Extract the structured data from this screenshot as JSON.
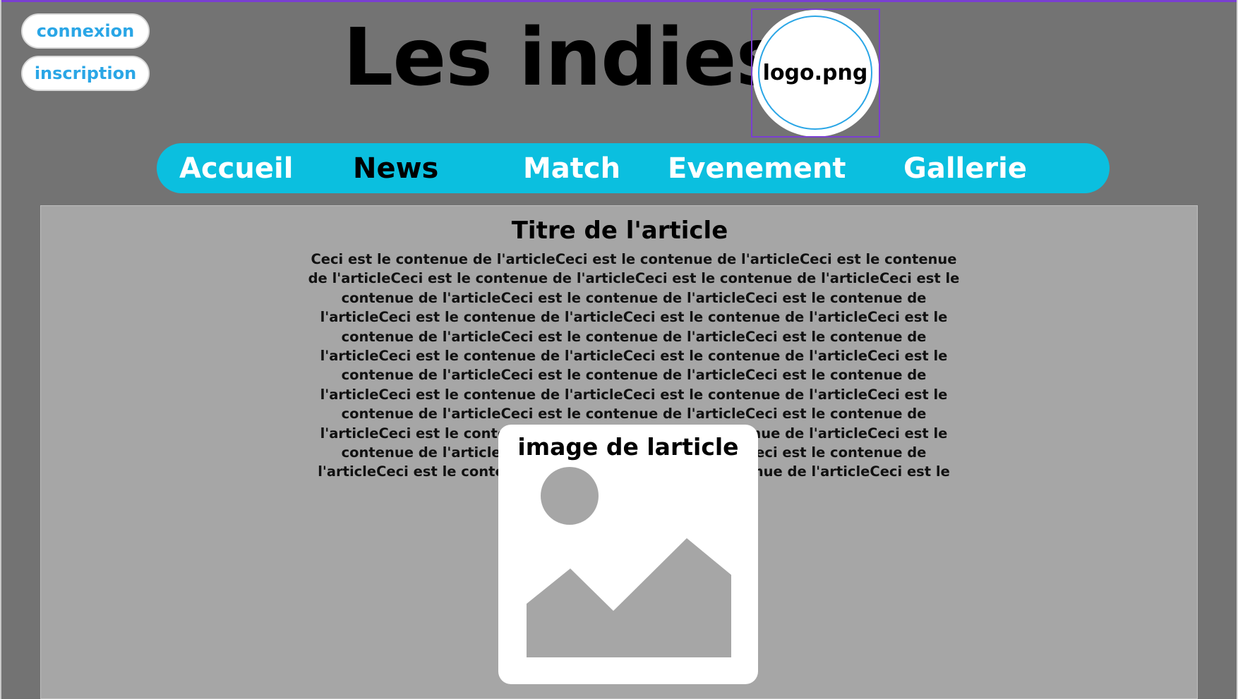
{
  "auth": {
    "login_label": "connexion",
    "register_label": "inscription"
  },
  "header": {
    "site_title": "Les indies",
    "logo_text": "logo.png"
  },
  "nav": {
    "items": [
      {
        "label": "Accueil",
        "active": false
      },
      {
        "label": "News",
        "active": true
      },
      {
        "label": "Match",
        "active": false
      },
      {
        "label": "Evenement",
        "active": false
      },
      {
        "label": "Gallerie",
        "active": false
      }
    ]
  },
  "article": {
    "title": "Titre de l'article",
    "body": "Ceci est le contenue de l'articleCeci est le contenue de l'articleCeci est le contenue de l'articleCeci est le contenue de l'articleCeci est le contenue de l'articleCeci est le contenue de l'articleCeci est le contenue de l'articleCeci est le contenue de l'articleCeci est le contenue de l'articleCeci est le contenue de l'articleCeci est le contenue de l'articleCeci est le contenue de l'articleCeci est le contenue de l'articleCeci est le contenue de l'articleCeci est le contenue de l'articleCeci est le contenue de l'articleCeci est le contenue de l'articleCeci est le contenue de l'articleCeci est le contenue de l'articleCeci est le contenue de l'articleCeci est le contenue de l'articleCeci est le contenue de l'articleCeci est le contenue de l'articleCeci est le contenue de l'articleCeci est le contenue de l'articleCeci est le contenue de l'articleCeci est le contenue de l'articleCeci est le contenue de l'articleCeci est le contenue de l'article Ceci est le contenue de l'articleCeci est le contenue de",
    "image_caption": "image de larticle",
    "image_icon": "image-placeholder-icon"
  },
  "colors": {
    "background": "#737373",
    "panel": "#a6a6a6",
    "nav": "#0bbfdf",
    "accent_text": "#2aa6e6",
    "selection": "#7a3fd1"
  }
}
